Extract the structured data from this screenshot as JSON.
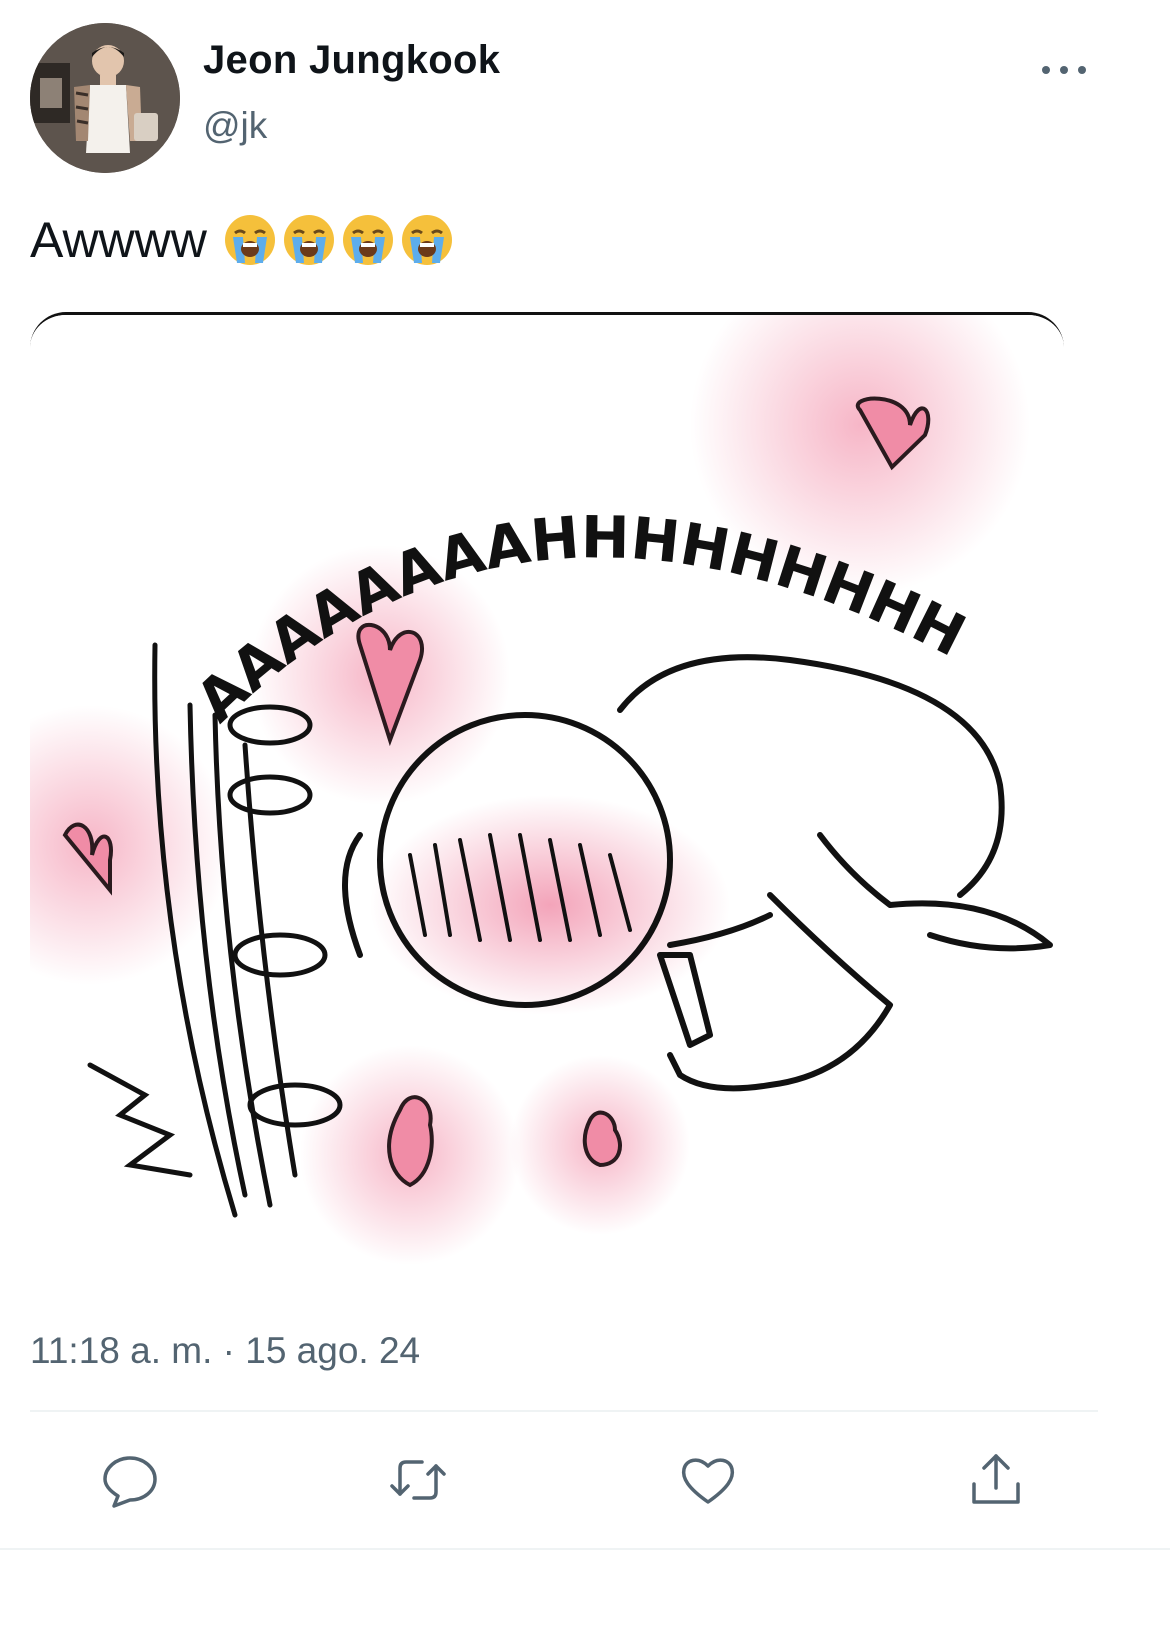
{
  "tweet": {
    "author_name": "Jeon Jungkook",
    "author_handle": "@jk",
    "text": "Awwww",
    "emojis": [
      "loudly-crying-face",
      "loudly-crying-face",
      "loudly-crying-face",
      "loudly-crying-face"
    ],
    "image_caption_text": "AAAAAAAAHHHHHHHHH",
    "timestamp": "11:18 a. m. · 15 ago. 24"
  },
  "actions": [
    {
      "name": "reply-icon"
    },
    {
      "name": "retweet-icon"
    },
    {
      "name": "like-icon"
    },
    {
      "name": "share-icon"
    }
  ],
  "colors": {
    "text": "#0f1419",
    "secondary": "#536471",
    "divider": "#eff3f4",
    "heart_pink": "#f08ca6",
    "blush": "#f7c6d3"
  }
}
